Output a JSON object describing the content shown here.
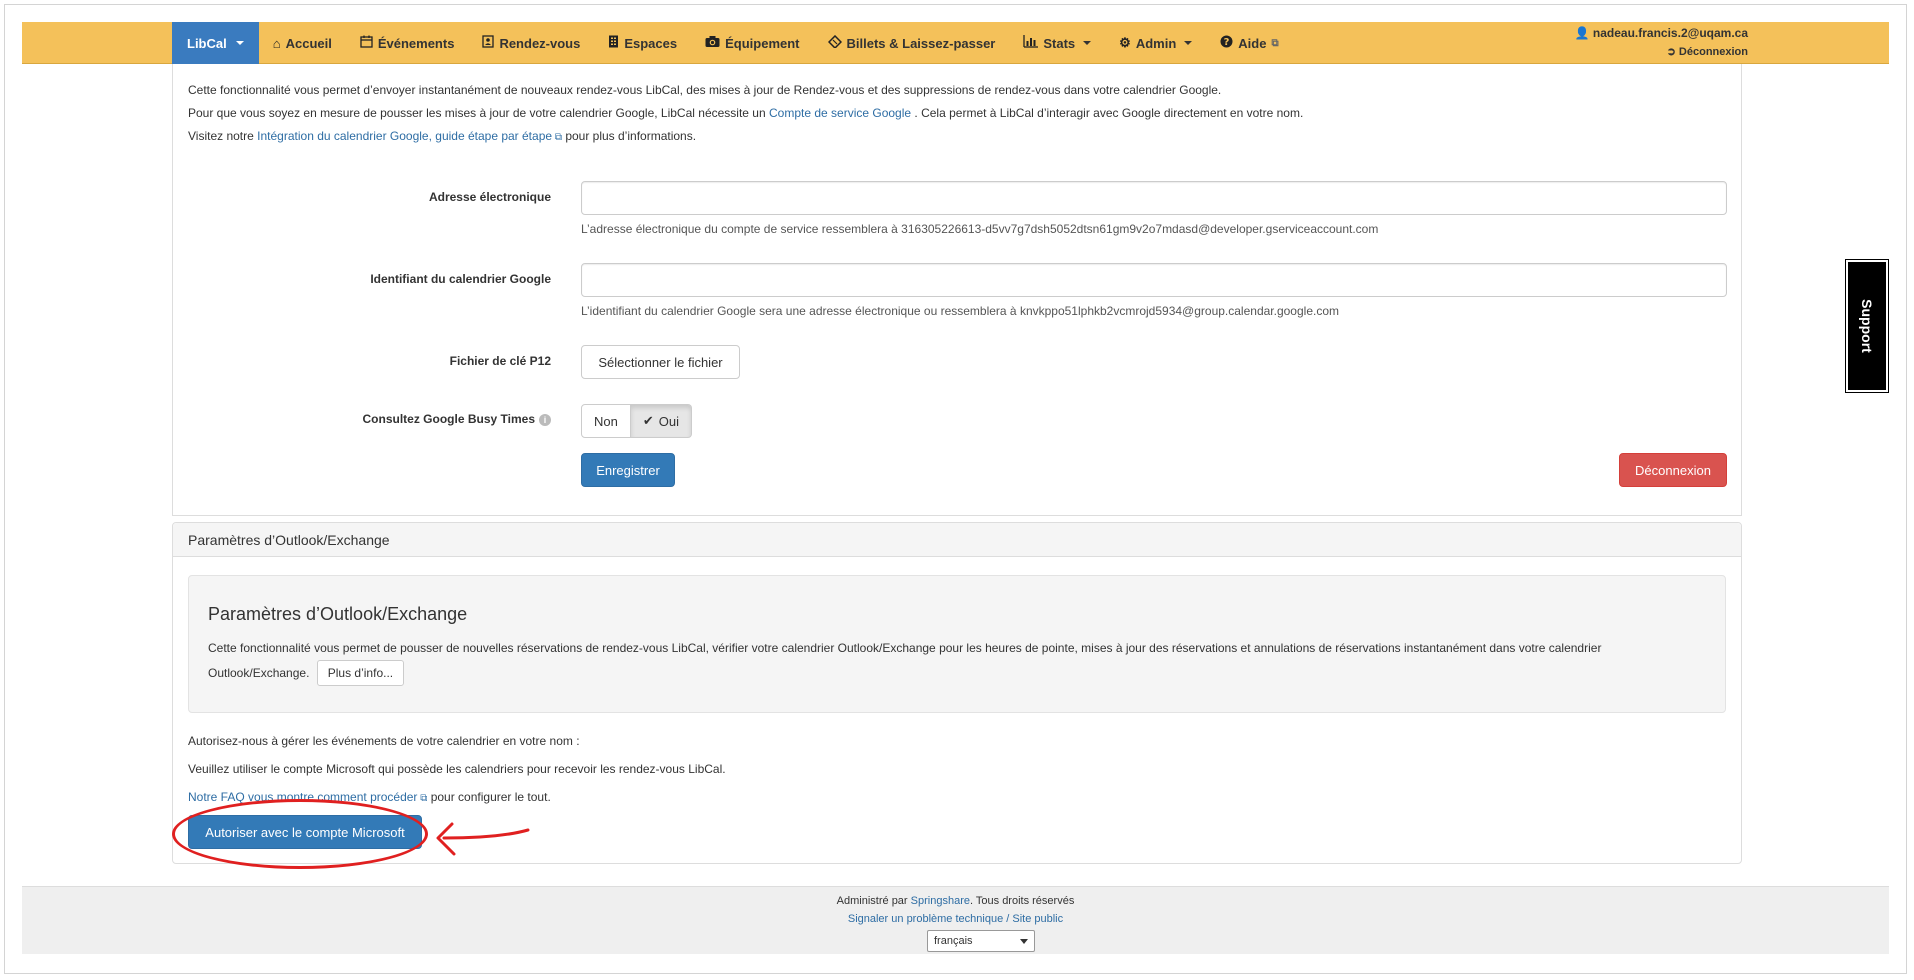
{
  "navbar": {
    "brand": "LibCal",
    "items": [
      {
        "label": "Accueil",
        "icon": "home-icon"
      },
      {
        "label": "Événements",
        "icon": "calendar-icon"
      },
      {
        "label": "Rendez-vous",
        "icon": "user-card-icon"
      },
      {
        "label": "Espaces",
        "icon": "building-icon"
      },
      {
        "label": "Équipement",
        "icon": "camera-icon"
      },
      {
        "label": "Billets & Laissez-passer",
        "icon": "ticket-icon"
      },
      {
        "label": "Stats",
        "icon": "bar-chart-icon"
      },
      {
        "label": "Admin",
        "icon": "gear-icon"
      },
      {
        "label": "Aide",
        "icon": "question-icon"
      }
    ],
    "user_email": "nadeau.francis.2@uqam.ca",
    "logout": "Déconnexion"
  },
  "google": {
    "intro1": "Cette fonctionnalité vous permet d’envoyer instantanément de nouveaux rendez-vous LibCal, des mises à jour de Rendez-vous et des suppressions de rendez-vous dans votre calendrier Google.",
    "intro2_a": "Pour que vous soyez en mesure de pousser les mises à jour de votre calendrier Google, LibCal nécessite un",
    "intro2_link": "Compte de service Google",
    "intro2_b": ". Cela permet à LibCal d’interagir avec Google directement en votre nom.",
    "intro3_a": "Visitez notre",
    "intro3_link": "Intégration du calendrier Google, guide étape par étape",
    "intro3_b": "pour plus d’informations.",
    "email_label": "Adresse électronique",
    "email_help": "L’adresse électronique du compte de service ressemblera à 316305226613-d5vv7g7dsh5052dtsn61gm9v2o7mdasd@developer.gserviceaccount.com",
    "calendar_label": "Identifiant du calendrier Google",
    "calendar_help": "L’identifiant du calendrier Google sera une adresse électronique ou ressemblera à knvkppo51lphkb2vcmrojd5934@group.calendar.google.com",
    "key_label": "Fichier de clé P12",
    "key_button": "Sélectionner le fichier",
    "busy_label": "Consultez Google Busy Times",
    "toggle_no": "Non",
    "toggle_yes": "Oui",
    "save": "Enregistrer",
    "disconnect": "Déconnexion"
  },
  "outlook": {
    "panel_heading": "Paramètres d’Outlook/Exchange",
    "well_title": "Paramètres d’Outlook/Exchange",
    "well_text": "Cette fonctionnalité vous permet de pousser de nouvelles réservations de rendez-vous LibCal, vérifier votre calendrier Outlook/Exchange pour les heures de pointe, mises à jour des réservations et annulations de réservations instantanément dans votre calendrier Outlook/Exchange.",
    "more_info": "Plus d’info...",
    "auth_text": "Autorisez-nous à gérer les événements de votre calendrier en votre nom :",
    "account_text": "Veuillez utiliser le compte Microsoft qui possède les calendriers pour recevoir les rendez-vous LibCal.",
    "faq_link": "Notre FAQ vous montre comment procéder",
    "faq_tail": "pour configurer le tout.",
    "authorize_button": "Autoriser avec le compte Microsoft"
  },
  "support": "Support",
  "footer": {
    "admin_prefix": "Administré par",
    "admin_link": "Springshare",
    "admin_suffix": ". Tous droits réservés",
    "report_link": "Signaler un problème technique",
    "separator": "/",
    "public_link": "Site public",
    "language": "français"
  },
  "colors": {
    "navbar": "#f4c15a",
    "brand": "#3a7bbf",
    "primary": "#337ab7",
    "danger": "#d9534f",
    "annotation": "#e02020"
  }
}
